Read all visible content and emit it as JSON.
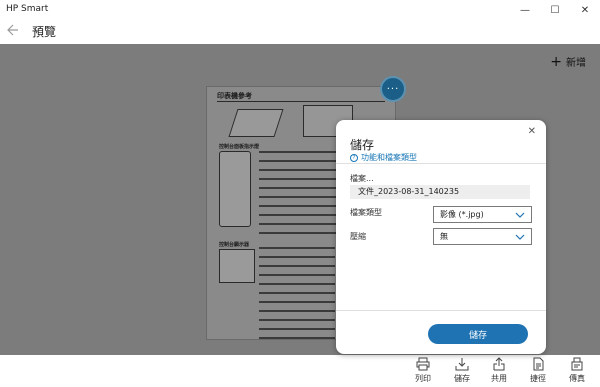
{
  "window": {
    "title": "HP Smart",
    "minimize_label": "—",
    "maximize_label": "☐",
    "close_label": "✕"
  },
  "header": {
    "title": "預覽"
  },
  "toolbar": {
    "add_label": "新增",
    "add_icon": "plus-icon"
  },
  "preview": {
    "doc_title": "印表機參考",
    "section1_title": "控制台面板指示燈",
    "section2_title": "控制台顯示器",
    "more_label": "···"
  },
  "dialog": {
    "title": "儲存",
    "close_label": "✕",
    "link_text": "功能和檔案類型",
    "file_label": "檔案...",
    "file_name": "文件_2023-08-31_140235",
    "type_label": "檔案類型",
    "type_value": "影像 (*.jpg)",
    "compression_label": "壓縮",
    "compression_value": "無",
    "save_label": "儲存"
  },
  "bottom_bar": {
    "items": [
      {
        "label": "列印",
        "icon": "printer-icon"
      },
      {
        "label": "儲存",
        "icon": "save-icon"
      },
      {
        "label": "共用",
        "icon": "share-icon"
      },
      {
        "label": "捷徑",
        "icon": "shortcut-icon"
      },
      {
        "label": "傳真",
        "icon": "fax-icon"
      }
    ]
  },
  "colors": {
    "accent": "#1f73b3",
    "link": "#1776b5",
    "content_bg": "#7c7c7c",
    "more_button": "#1b5e87"
  }
}
